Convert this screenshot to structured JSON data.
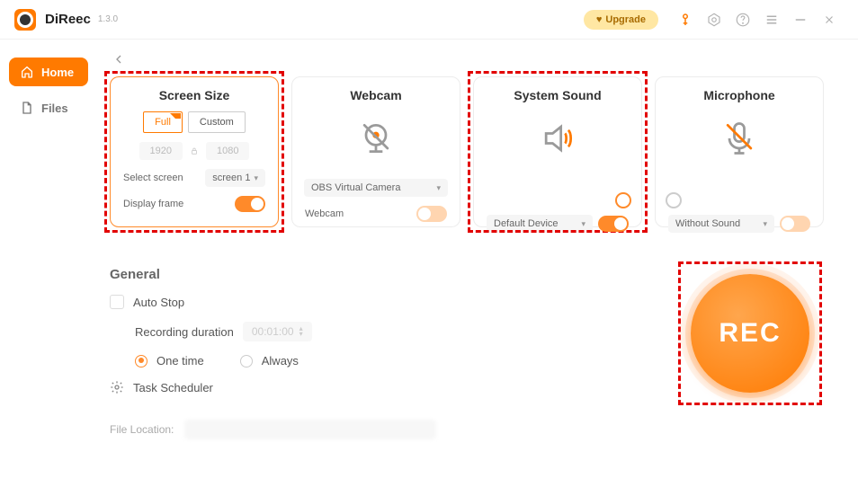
{
  "app": {
    "name": "DiReec",
    "version": "1.3.0"
  },
  "titlebar": {
    "upgrade": "Upgrade"
  },
  "sidebar": {
    "home": "Home",
    "files": "Files"
  },
  "cards": {
    "screen": {
      "title": "Screen Size",
      "full": "Full",
      "custom": "Custom",
      "w": "1920",
      "h": "1080",
      "select_label": "Select screen",
      "select_value": "screen 1",
      "frame_label": "Display frame"
    },
    "webcam": {
      "title": "Webcam",
      "device": "OBS Virtual Camera",
      "label": "Webcam"
    },
    "system_sound": {
      "title": "System Sound",
      "device": "Default Device"
    },
    "mic": {
      "title": "Microphone",
      "device": "Without Sound"
    }
  },
  "general": {
    "title": "General",
    "auto_stop": "Auto Stop",
    "rec_dur_label": "Recording duration",
    "rec_dur_value": "00:01:00",
    "one_time": "One time",
    "always": "Always",
    "task_scheduler": "Task Scheduler",
    "file_location": "File Location:"
  },
  "rec": {
    "label": "REC"
  }
}
